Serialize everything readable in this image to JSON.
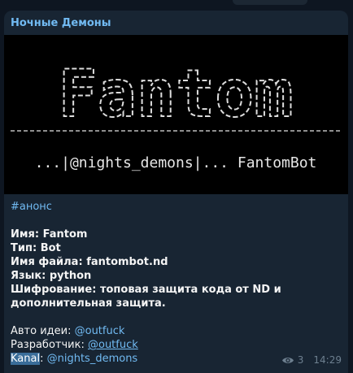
{
  "message": {
    "sender": "Ночные Демоны",
    "banner": {
      "logo_text": "Fantom",
      "tagline": "...|@nights_demons|... FantomBot"
    },
    "hashtag": "#анонс",
    "fields": [
      {
        "label": "Имя: ",
        "value": "Fantom"
      },
      {
        "label": "Тип: ",
        "value": "Bot"
      },
      {
        "label": "Имя файла: ",
        "value": "fantombot.nd"
      },
      {
        "label": "Язык: ",
        "value": "python"
      },
      {
        "label": "Шифрование: ",
        "value": "топовая защита кода от ND и"
      },
      {
        "label": "",
        "value": "дополнительная защита."
      }
    ],
    "credits": [
      {
        "label": "Авто идеи: ",
        "link": "@outfuck"
      },
      {
        "label": "Разработчик: ",
        "link": "@outfuck"
      },
      {
        "label_highlight": "Kanal",
        "label_rest": ": ",
        "link": "@nights_demons"
      }
    ],
    "views": "3",
    "time": "14:29"
  }
}
